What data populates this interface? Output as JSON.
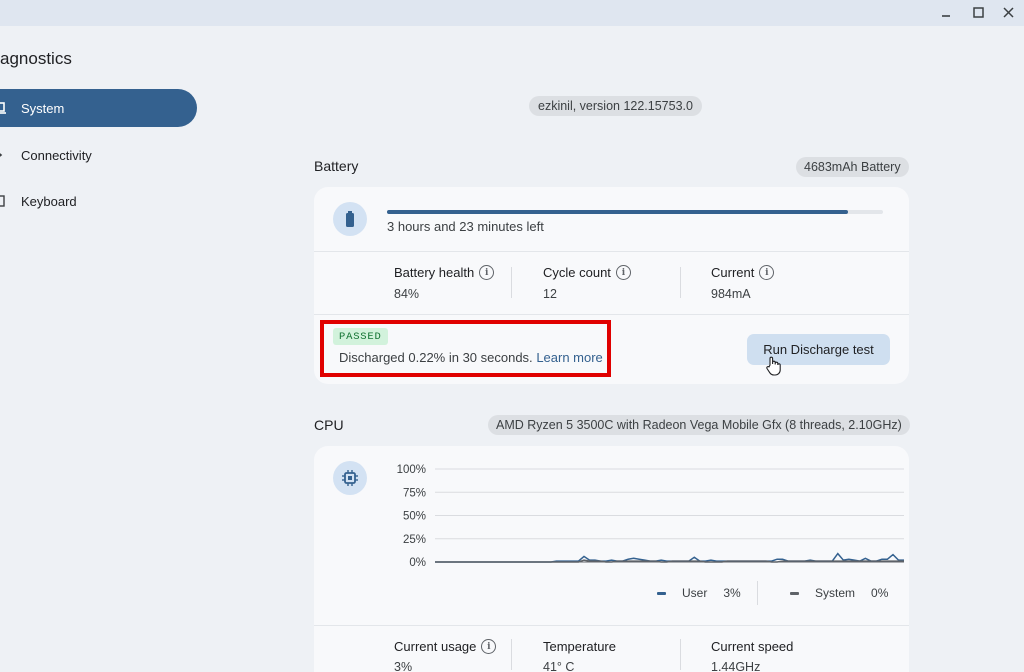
{
  "window": {
    "minimize_icon": "minimize-icon",
    "maximize_icon": "maximize-icon",
    "close_icon": "close-icon"
  },
  "app": {
    "title": "agnostics"
  },
  "sidebar": {
    "items": [
      {
        "label": "System",
        "icon": "laptop-icon",
        "active": true
      },
      {
        "label": "Connectivity",
        "icon": "connectivity-icon",
        "active": false
      },
      {
        "label": "Keyboard",
        "icon": "keyboard-icon",
        "active": false
      }
    ]
  },
  "header": {
    "version": "ezkinil, version 122.15753.0"
  },
  "battery": {
    "title": "Battery",
    "capacity": "4683mAh Battery",
    "time_left": "3 hours and 23 minutes left",
    "charge_fraction": 0.93,
    "stats": [
      {
        "label": "Battery health",
        "value": "84%"
      },
      {
        "label": "Cycle count",
        "value": "12"
      },
      {
        "label": "Current",
        "value": "984mA"
      }
    ],
    "test_status": "PASSED",
    "result_text": "Discharged 0.22% in 30 seconds.",
    "learn_more": "Learn more",
    "run_button": "Run Discharge test"
  },
  "cpu": {
    "title": "CPU",
    "model": "AMD Ryzen 5 3500C with Radeon Vega Mobile Gfx (8 threads, 2.10GHz)",
    "legend": [
      {
        "name": "User",
        "value": "3%",
        "color": "#34618f"
      },
      {
        "name": "System",
        "value": "0%",
        "color": "#5f6368"
      }
    ],
    "stats": [
      {
        "label": "Current usage",
        "value": "3%"
      },
      {
        "label": "Temperature",
        "value": "41° C"
      },
      {
        "label": "Current speed",
        "value": "1.44GHz"
      }
    ]
  },
  "chart_data": {
    "type": "line",
    "ylim": [
      0,
      100
    ],
    "y_ticks": [
      "100%",
      "75%",
      "50%",
      "25%",
      "0%"
    ],
    "series": [
      {
        "name": "User",
        "values": [
          0,
          0,
          0,
          0,
          0,
          0,
          0,
          0,
          0,
          0,
          0,
          0,
          0,
          0,
          0,
          0,
          0,
          0,
          0,
          0,
          0,
          0,
          1,
          1,
          1,
          1,
          1,
          6,
          2,
          2,
          1,
          1,
          2,
          1,
          1,
          3,
          4,
          3,
          2,
          1,
          1,
          2,
          1,
          1,
          1,
          1,
          1,
          5,
          1,
          1,
          2,
          1,
          1,
          1,
          1,
          1,
          1,
          1,
          1,
          1,
          1,
          1,
          3,
          3,
          1,
          1,
          1,
          1,
          2,
          1,
          1,
          1,
          1,
          9,
          2,
          3,
          2,
          1,
          4,
          1,
          1,
          3,
          3,
          8,
          2,
          2
        ]
      },
      {
        "name": "System",
        "values": [
          0,
          0,
          0,
          0,
          0,
          0,
          0,
          0,
          0,
          0,
          0,
          0,
          0,
          0,
          0,
          0,
          0,
          0,
          0,
          0,
          0,
          0,
          0,
          0,
          0,
          0,
          0,
          2,
          1,
          1,
          1,
          0,
          0,
          1,
          1,
          1,
          1,
          1,
          1,
          1,
          1,
          0,
          0,
          1,
          1,
          1,
          1,
          1,
          1,
          0,
          0,
          0,
          0,
          1,
          1,
          1,
          1,
          1,
          1,
          1,
          1,
          0,
          0,
          1,
          1,
          1,
          1,
          1,
          1,
          1,
          1,
          1,
          1,
          1,
          1,
          1,
          1,
          1,
          1,
          1,
          1,
          1,
          1,
          1,
          1,
          1
        ]
      }
    ]
  }
}
